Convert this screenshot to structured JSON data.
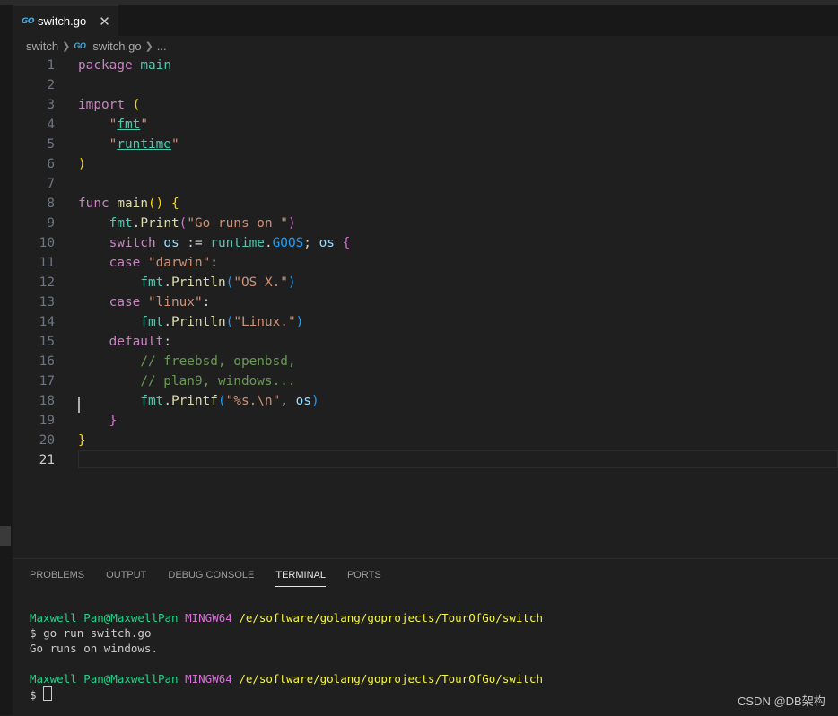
{
  "tab": {
    "icon": "go-file-icon",
    "icon_text": "GO",
    "label": "switch.go",
    "close": "✕"
  },
  "breadcrumb": {
    "folder": "switch",
    "file": "switch.go",
    "more": "..."
  },
  "editor": {
    "line_numbers": [
      "1",
      "2",
      "3",
      "4",
      "5",
      "6",
      "7",
      "8",
      "9",
      "10",
      "11",
      "12",
      "13",
      "14",
      "15",
      "16",
      "17",
      "18",
      "19",
      "20",
      "21"
    ],
    "lines": [
      [
        [
          "kw",
          "package"
        ],
        [
          "plain",
          " "
        ],
        [
          "pkg",
          "main"
        ]
      ],
      [],
      [
        [
          "kw",
          "import"
        ],
        [
          "plain",
          " "
        ],
        [
          "p1",
          "("
        ]
      ],
      [
        [
          "plain",
          "    "
        ],
        [
          "str",
          "\""
        ],
        [
          "pkg link",
          "fmt"
        ],
        [
          "str",
          "\""
        ]
      ],
      [
        [
          "plain",
          "    "
        ],
        [
          "str",
          "\""
        ],
        [
          "pkg link",
          "runtime"
        ],
        [
          "str",
          "\""
        ]
      ],
      [
        [
          "p1",
          ")"
        ]
      ],
      [],
      [
        [
          "kw",
          "func"
        ],
        [
          "plain",
          " "
        ],
        [
          "fn",
          "main"
        ],
        [
          "p1",
          "()"
        ],
        [
          "plain",
          " "
        ],
        [
          "p1",
          "{"
        ]
      ],
      [
        [
          "plain",
          "    "
        ],
        [
          "pkg",
          "fmt"
        ],
        [
          "plain",
          "."
        ],
        [
          "fn",
          "Print"
        ],
        [
          "p2",
          "("
        ],
        [
          "str",
          "\"Go runs on \""
        ],
        [
          "p2",
          ")"
        ]
      ],
      [
        [
          "plain",
          "    "
        ],
        [
          "kw",
          "switch"
        ],
        [
          "plain",
          " "
        ],
        [
          "var",
          "os"
        ],
        [
          "plain",
          " := "
        ],
        [
          "pkg",
          "runtime"
        ],
        [
          "plain",
          "."
        ],
        [
          "p3",
          "GOOS"
        ],
        [
          "plain",
          "; "
        ],
        [
          "var",
          "os"
        ],
        [
          "plain",
          " "
        ],
        [
          "p2",
          "{"
        ]
      ],
      [
        [
          "plain",
          "    "
        ],
        [
          "kw",
          "case"
        ],
        [
          "plain",
          " "
        ],
        [
          "str",
          "\"darwin\""
        ],
        [
          "plain",
          ":"
        ]
      ],
      [
        [
          "plain",
          "        "
        ],
        [
          "pkg",
          "fmt"
        ],
        [
          "plain",
          "."
        ],
        [
          "fn",
          "Println"
        ],
        [
          "p3",
          "("
        ],
        [
          "str",
          "\"OS X.\""
        ],
        [
          "p3",
          ")"
        ]
      ],
      [
        [
          "plain",
          "    "
        ],
        [
          "kw",
          "case"
        ],
        [
          "plain",
          " "
        ],
        [
          "str",
          "\"linux\""
        ],
        [
          "plain",
          ":"
        ]
      ],
      [
        [
          "plain",
          "        "
        ],
        [
          "pkg",
          "fmt"
        ],
        [
          "plain",
          "."
        ],
        [
          "fn",
          "Println"
        ],
        [
          "p3",
          "("
        ],
        [
          "str",
          "\"Linux.\""
        ],
        [
          "p3",
          ")"
        ]
      ],
      [
        [
          "plain",
          "    "
        ],
        [
          "kw",
          "default"
        ],
        [
          "plain",
          ":"
        ]
      ],
      [
        [
          "plain",
          "        "
        ],
        [
          "cmt",
          "// freebsd, openbsd,"
        ]
      ],
      [
        [
          "plain",
          "        "
        ],
        [
          "cmt",
          "// plan9, windows..."
        ]
      ],
      [
        [
          "plain",
          "        "
        ],
        [
          "pkg",
          "fmt"
        ],
        [
          "plain",
          "."
        ],
        [
          "fn",
          "Printf"
        ],
        [
          "p3",
          "("
        ],
        [
          "str",
          "\"%s.\\n\""
        ],
        [
          "plain",
          ", "
        ],
        [
          "var",
          "os"
        ],
        [
          "p3",
          ")"
        ]
      ],
      [
        [
          "plain",
          "    "
        ],
        [
          "p2",
          "}"
        ]
      ],
      [
        [
          "p1",
          "}"
        ]
      ],
      []
    ]
  },
  "panel": {
    "tabs": [
      {
        "label": "PROBLEMS",
        "active": false
      },
      {
        "label": "OUTPUT",
        "active": false
      },
      {
        "label": "DEBUG CONSOLE",
        "active": false
      },
      {
        "label": "TERMINAL",
        "active": true
      },
      {
        "label": "PORTS",
        "active": false
      }
    ]
  },
  "terminal": {
    "user": "Maxwell Pan@MaxwellPan",
    "shell": "MINGW64",
    "path": "/e/software/golang/goprojects/TourOfGo/switch",
    "prompt": "$",
    "command": "go run switch.go",
    "output": "Go runs on windows."
  },
  "watermark": "CSDN @DB架构"
}
